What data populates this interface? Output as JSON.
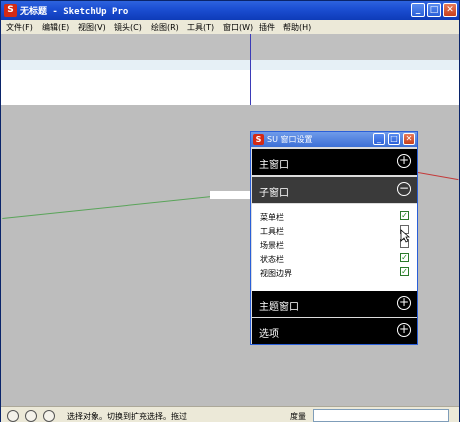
{
  "window": {
    "title": "无标题 - SketchUp Pro",
    "app_icon": "sketchup-logo",
    "minimize": "_",
    "maximize": "□",
    "close": "✕"
  },
  "menu": {
    "items": [
      {
        "label": "文件(F)"
      },
      {
        "label": "编辑(E)"
      },
      {
        "label": "视图(V)"
      },
      {
        "label": "镜头(C)"
      },
      {
        "label": "绘图(R)"
      },
      {
        "label": "工具(T)"
      },
      {
        "label": "窗口(W)"
      },
      {
        "label": "插件"
      },
      {
        "label": "帮助(H)"
      }
    ]
  },
  "settings_window": {
    "title": "SU 窗口设置",
    "sections": {
      "main_window": {
        "label": "主窗口",
        "toggle": "+"
      },
      "sub_window": {
        "label": "子窗口",
        "toggle": "−"
      },
      "theme_window": {
        "label": "主题窗口",
        "toggle": "+"
      },
      "options": {
        "label": "选项",
        "toggle": "+"
      }
    },
    "sub_window_options": [
      {
        "label": "菜单栏",
        "checked": true,
        "mark": "✓"
      },
      {
        "label": "工具栏",
        "checked": false,
        "mark": ""
      },
      {
        "label": "场景栏",
        "checked": false,
        "mark": ""
      },
      {
        "label": "状态栏",
        "checked": true,
        "mark": "✓"
      },
      {
        "label": "视图边界",
        "checked": true,
        "mark": "✓"
      }
    ]
  },
  "status_bar": {
    "text": "选择对象。切换到扩充选择。拖过",
    "measure_label": "度量",
    "measure_value": ""
  },
  "colors": {
    "axis_blue": "#3b3bb8",
    "axis_red": "#c43a3a",
    "axis_green": "#2f9a2f",
    "check_green": "#1f8a1f"
  }
}
